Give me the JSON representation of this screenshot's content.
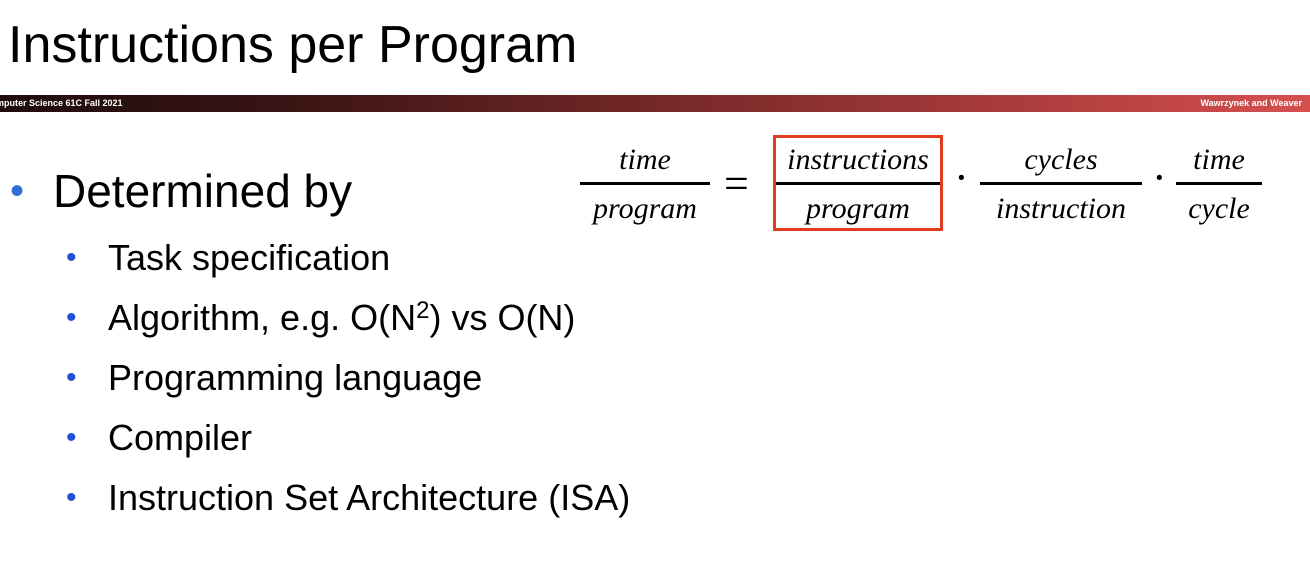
{
  "slide": {
    "title": "Instructions per Program",
    "header_bar": {
      "left_text": "mputer Science 61C Fall 2021",
      "right_text": "Wawrzynek and Weaver"
    },
    "main_bullet": "Determined by",
    "sub_bullets": [
      {
        "pre": "Task specification",
        "sup": "",
        "post": ""
      },
      {
        "pre": "Algorithm, e.g. O(N",
        "sup": "2",
        "post": ") vs O(N)"
      },
      {
        "pre": "Programming language",
        "sup": "",
        "post": ""
      },
      {
        "pre": "Compiler",
        "sup": "",
        "post": ""
      },
      {
        "pre": "Instruction Set Architecture (ISA)",
        "sup": "",
        "post": ""
      }
    ],
    "bullet_glyph": "•",
    "equation": {
      "lhs": {
        "num": "time",
        "den": "program"
      },
      "equals": "=",
      "dot": "·",
      "terms": [
        {
          "num": "instructions",
          "den": "program",
          "highlighted": true
        },
        {
          "num": "cycles",
          "den": "instruction",
          "highlighted": false
        },
        {
          "num": "time",
          "den": "cycle",
          "highlighted": false
        }
      ]
    },
    "colors": {
      "bullet_main": "#2f6fd6",
      "bullet_sub": "#1f4fd6",
      "highlight_border": "#e23b1f",
      "bar_dark": "#1e0b0b",
      "bar_light": "#d64f4f"
    }
  }
}
